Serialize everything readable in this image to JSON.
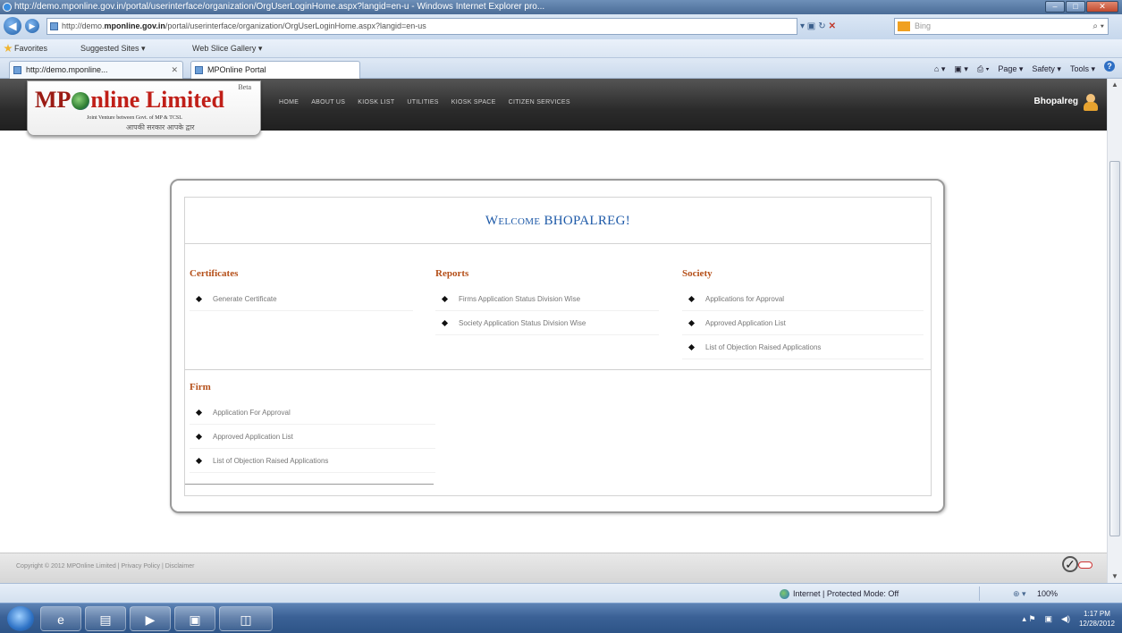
{
  "browser": {
    "window_title": "http://demo.mponline.gov.in/portal/userinterface/organization/OrgUserLoginHome.aspx?langid=en-u - Windows Internet Explorer pro...",
    "address_prefix": "http://demo.",
    "address_domain": "mponline.gov.in",
    "address_path": "/portal/userinterface/organization/OrgUserLoginHome.aspx?langid=en-us",
    "search_placeholder": "Bing",
    "favorites_label": "Favorites",
    "suggested_sites": "Suggested Sites ▾",
    "web_slice_gallery": "Web Slice Gallery ▾",
    "tabs": [
      {
        "label": "http://demo.mponline..."
      },
      {
        "label": "MPOnline Portal"
      }
    ],
    "command_bar": {
      "page": "Page ▾",
      "safety": "Safety ▾",
      "tools": "Tools ▾",
      "help": "?"
    },
    "status_zone": "Internet | Protected Mode: Off",
    "zoom": "100%"
  },
  "site": {
    "logo_beta": "Beta",
    "logo_mp": "MP",
    "logo_rest": "nline Limited",
    "logo_tagline": "Joint Venture between Govt. of MP & TCSL",
    "logo_hindi": "आपकी सरकार आपके द्वार",
    "nav": [
      "HOME",
      "ABOUT US",
      "KIOSK LIST",
      "UTILITIES",
      "KIOSK SPACE",
      "CITIZEN SERVICES"
    ],
    "username": "Bhopalreg",
    "welcome": "Welcome BHOPALREG!",
    "footer": "Copyright © 2012 MPOnline Limited | Privacy Policy | Disclaimer"
  },
  "sections": {
    "certificates": {
      "title": "Certificates",
      "items": [
        "Generate Certificate"
      ]
    },
    "reports": {
      "title": "Reports",
      "items": [
        "Firms Application Status Division Wise",
        "Society Application Status Division Wise"
      ]
    },
    "society": {
      "title": "Society",
      "items": [
        "Applications for Approval",
        "Approved Application List",
        "List of Objection Raised Applications"
      ]
    },
    "firm": {
      "title": "Firm",
      "items": [
        "Application For Approval",
        "Approved Application List",
        "List of Objection Raised Applications"
      ]
    }
  },
  "taskbar": {
    "time": "1:17 PM",
    "date": "12/28/2012"
  }
}
